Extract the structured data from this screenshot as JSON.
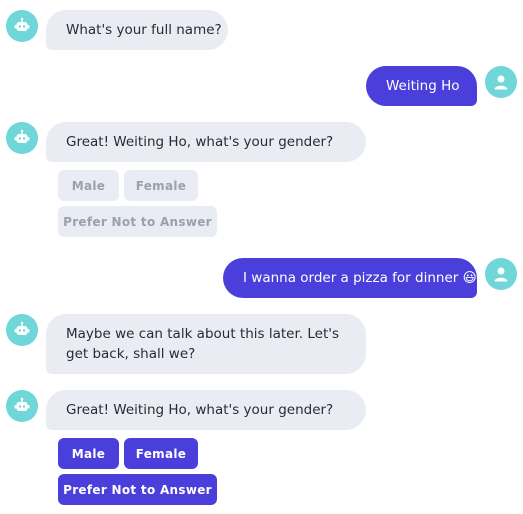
{
  "theme": {
    "bot_bubble": "#e9ecf3",
    "user_bubble": "#4a3fdb",
    "avatar": "#6fd6d9",
    "button_disabled": "#e9ecf3",
    "button_active": "#4a3fdb"
  },
  "messages": [
    {
      "sender": "bot",
      "avatar_icon": "robot-icon",
      "text": "What's your full name?"
    },
    {
      "sender": "user",
      "avatar_icon": "user-icon",
      "text": "Weiting Ho"
    },
    {
      "sender": "bot",
      "avatar_icon": "robot-icon",
      "text": "Great! Weiting Ho, what's your gender?",
      "options": [
        "Male",
        "Female",
        "Prefer Not to Answer"
      ],
      "options_state": "disabled"
    },
    {
      "sender": "user",
      "avatar_icon": "user-icon",
      "text": "I wanna order a pizza for dinner 😃"
    },
    {
      "sender": "bot",
      "avatar_icon": "robot-icon",
      "text": "Maybe we can talk about this later. Let's get back, shall we?"
    },
    {
      "sender": "bot",
      "avatar_icon": "robot-icon",
      "text": "Great! Weiting Ho, what's your gender?",
      "options": [
        "Male",
        "Female",
        "Prefer Not to Answer"
      ],
      "options_state": "active"
    }
  ]
}
